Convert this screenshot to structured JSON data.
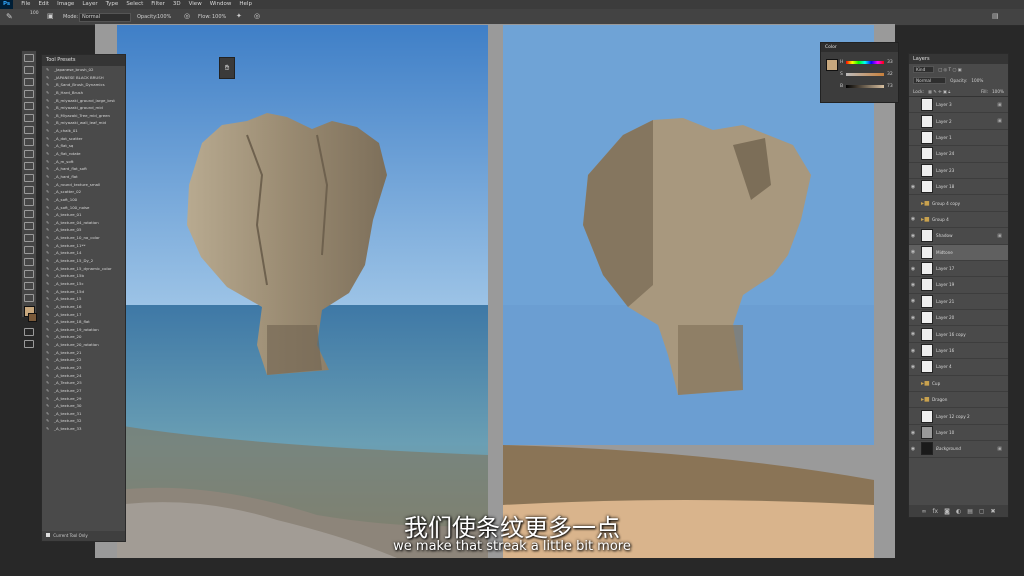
{
  "menubar": {
    "app_logo": "Ps",
    "items": [
      "File",
      "Edit",
      "Image",
      "Layer",
      "Type",
      "Select",
      "Filter",
      "3D",
      "View",
      "Window",
      "Help"
    ]
  },
  "options": {
    "brush_size": "100",
    "mode_label": "Mode:",
    "mode_value": "Normal",
    "opacity_label": "Opacity:",
    "opacity_value": "100%",
    "flow_label": "Flow:",
    "flow_value": "100%"
  },
  "tool_presets": {
    "title": "Tool Presets",
    "items": [
      "_Japanese_brush_02",
      "_JAPANESE BLACK BRUSH",
      "_B_Sand_Brush_Dynamics",
      "_B_Hard_Brush",
      "_B_miyazaki_ground_large_brst",
      "_B_miyazaki_ground_mid",
      "_B_Miyazaki_Tree_mid_green",
      "_B_miyazaki_wall_leaf_mid",
      "_A_chalk_01",
      "_A_dot_scatter",
      "_A_flat_sq",
      "_A_flat_rotate",
      "_A_m_soft",
      "_A_hard_flat_soft",
      "_A_hard_flat",
      "_A_round_texture_small",
      "_A_scatter_02",
      "_A_soft_100",
      "_A_soft_100_noise",
      "_A_texture_01",
      "_A_texture_04_rotation",
      "_A_texture_05",
      "_A_texture_10_no_color",
      "_A_texture_11**",
      "_A_texture_14",
      "_A_texture_15_Dy_2",
      "_A_texture_15_dynamic_color",
      "_A_texture_15b",
      "_A_texture_15c",
      "_A_texture_15d",
      "_A_texture_15",
      "_A_texture_16",
      "_A_texture_17",
      "_A_texture_18_flat",
      "_A_texture_19_rotation",
      "_A_texture_20",
      "_A_texture_20_rotation",
      "_A_texture_21",
      "_A_texture_22",
      "_A_texture_23",
      "_A_texture_24",
      "_A_Texture_25",
      "_A_texture_27",
      "_A_texture_29",
      "_A_texture_30",
      "_A_texture_31",
      "_A_texture_32",
      "_A_texture_33"
    ],
    "footer": "Current Tool Only"
  },
  "color_panel": {
    "title": "Color",
    "h_label": "H",
    "h_value": "33",
    "s_label": "S",
    "s_value": "32",
    "b_label": "B",
    "b_value": "73",
    "foreground": "#c8a87e"
  },
  "layers_panel": {
    "title": "Layers",
    "kind_label": "Kind",
    "blend_mode": "Normal",
    "opacity_label": "Opacity:",
    "opacity_value": "100%",
    "lock_label": "Lock:",
    "fill_label": "Fill:",
    "fill_value": "100%",
    "layers": [
      {
        "name": "Layer 3",
        "type": "layer",
        "visible": false,
        "locked": true
      },
      {
        "name": "Layer 2",
        "type": "layer",
        "visible": false,
        "locked": true
      },
      {
        "name": "Layer 1",
        "type": "layer",
        "visible": false,
        "locked": false
      },
      {
        "name": "Layer 24",
        "type": "layer",
        "visible": false,
        "locked": false
      },
      {
        "name": "Layer 23",
        "type": "layer",
        "visible": false,
        "locked": false
      },
      {
        "name": "Layer 18",
        "type": "layer",
        "visible": true,
        "locked": false
      },
      {
        "name": "Group 4 copy",
        "type": "group",
        "visible": false,
        "locked": false
      },
      {
        "name": "Group 4",
        "type": "group",
        "visible": true,
        "locked": false
      },
      {
        "name": "Shadow",
        "type": "layer",
        "visible": true,
        "locked": true
      },
      {
        "name": "Midtone",
        "type": "layer",
        "visible": true,
        "locked": false,
        "selected": true
      },
      {
        "name": "Layer 17",
        "type": "layer",
        "visible": true,
        "locked": false
      },
      {
        "name": "Layer 19",
        "type": "layer",
        "visible": true,
        "locked": false
      },
      {
        "name": "Layer 21",
        "type": "layer",
        "visible": true,
        "locked": false
      },
      {
        "name": "Layer 20",
        "type": "layer",
        "visible": true,
        "locked": false
      },
      {
        "name": "Layer 16 copy",
        "type": "layer",
        "visible": true,
        "locked": false
      },
      {
        "name": "Layer 16",
        "type": "layer",
        "visible": true,
        "locked": false
      },
      {
        "name": "Layer 4",
        "type": "layer",
        "visible": true,
        "locked": false
      },
      {
        "name": "Cup",
        "type": "group",
        "visible": false,
        "locked": false
      },
      {
        "name": "Dragon",
        "type": "group",
        "visible": false,
        "locked": false
      },
      {
        "name": "Layer 12 copy 2",
        "type": "layer",
        "visible": false,
        "locked": false
      },
      {
        "name": "Layer 10",
        "type": "layer",
        "visible": true,
        "locked": false
      },
      {
        "name": "Background",
        "type": "layer",
        "visible": true,
        "locked": true
      }
    ]
  },
  "subtitles": {
    "chinese": "我们使条纹更多一点",
    "english": "we make that streak a little bit more"
  },
  "colors": {
    "sky": "#5d93c9",
    "sea": "#6fa2d1",
    "sand": "#d8b28a",
    "ground": "#7a6a52",
    "rock": "#a89a82"
  }
}
